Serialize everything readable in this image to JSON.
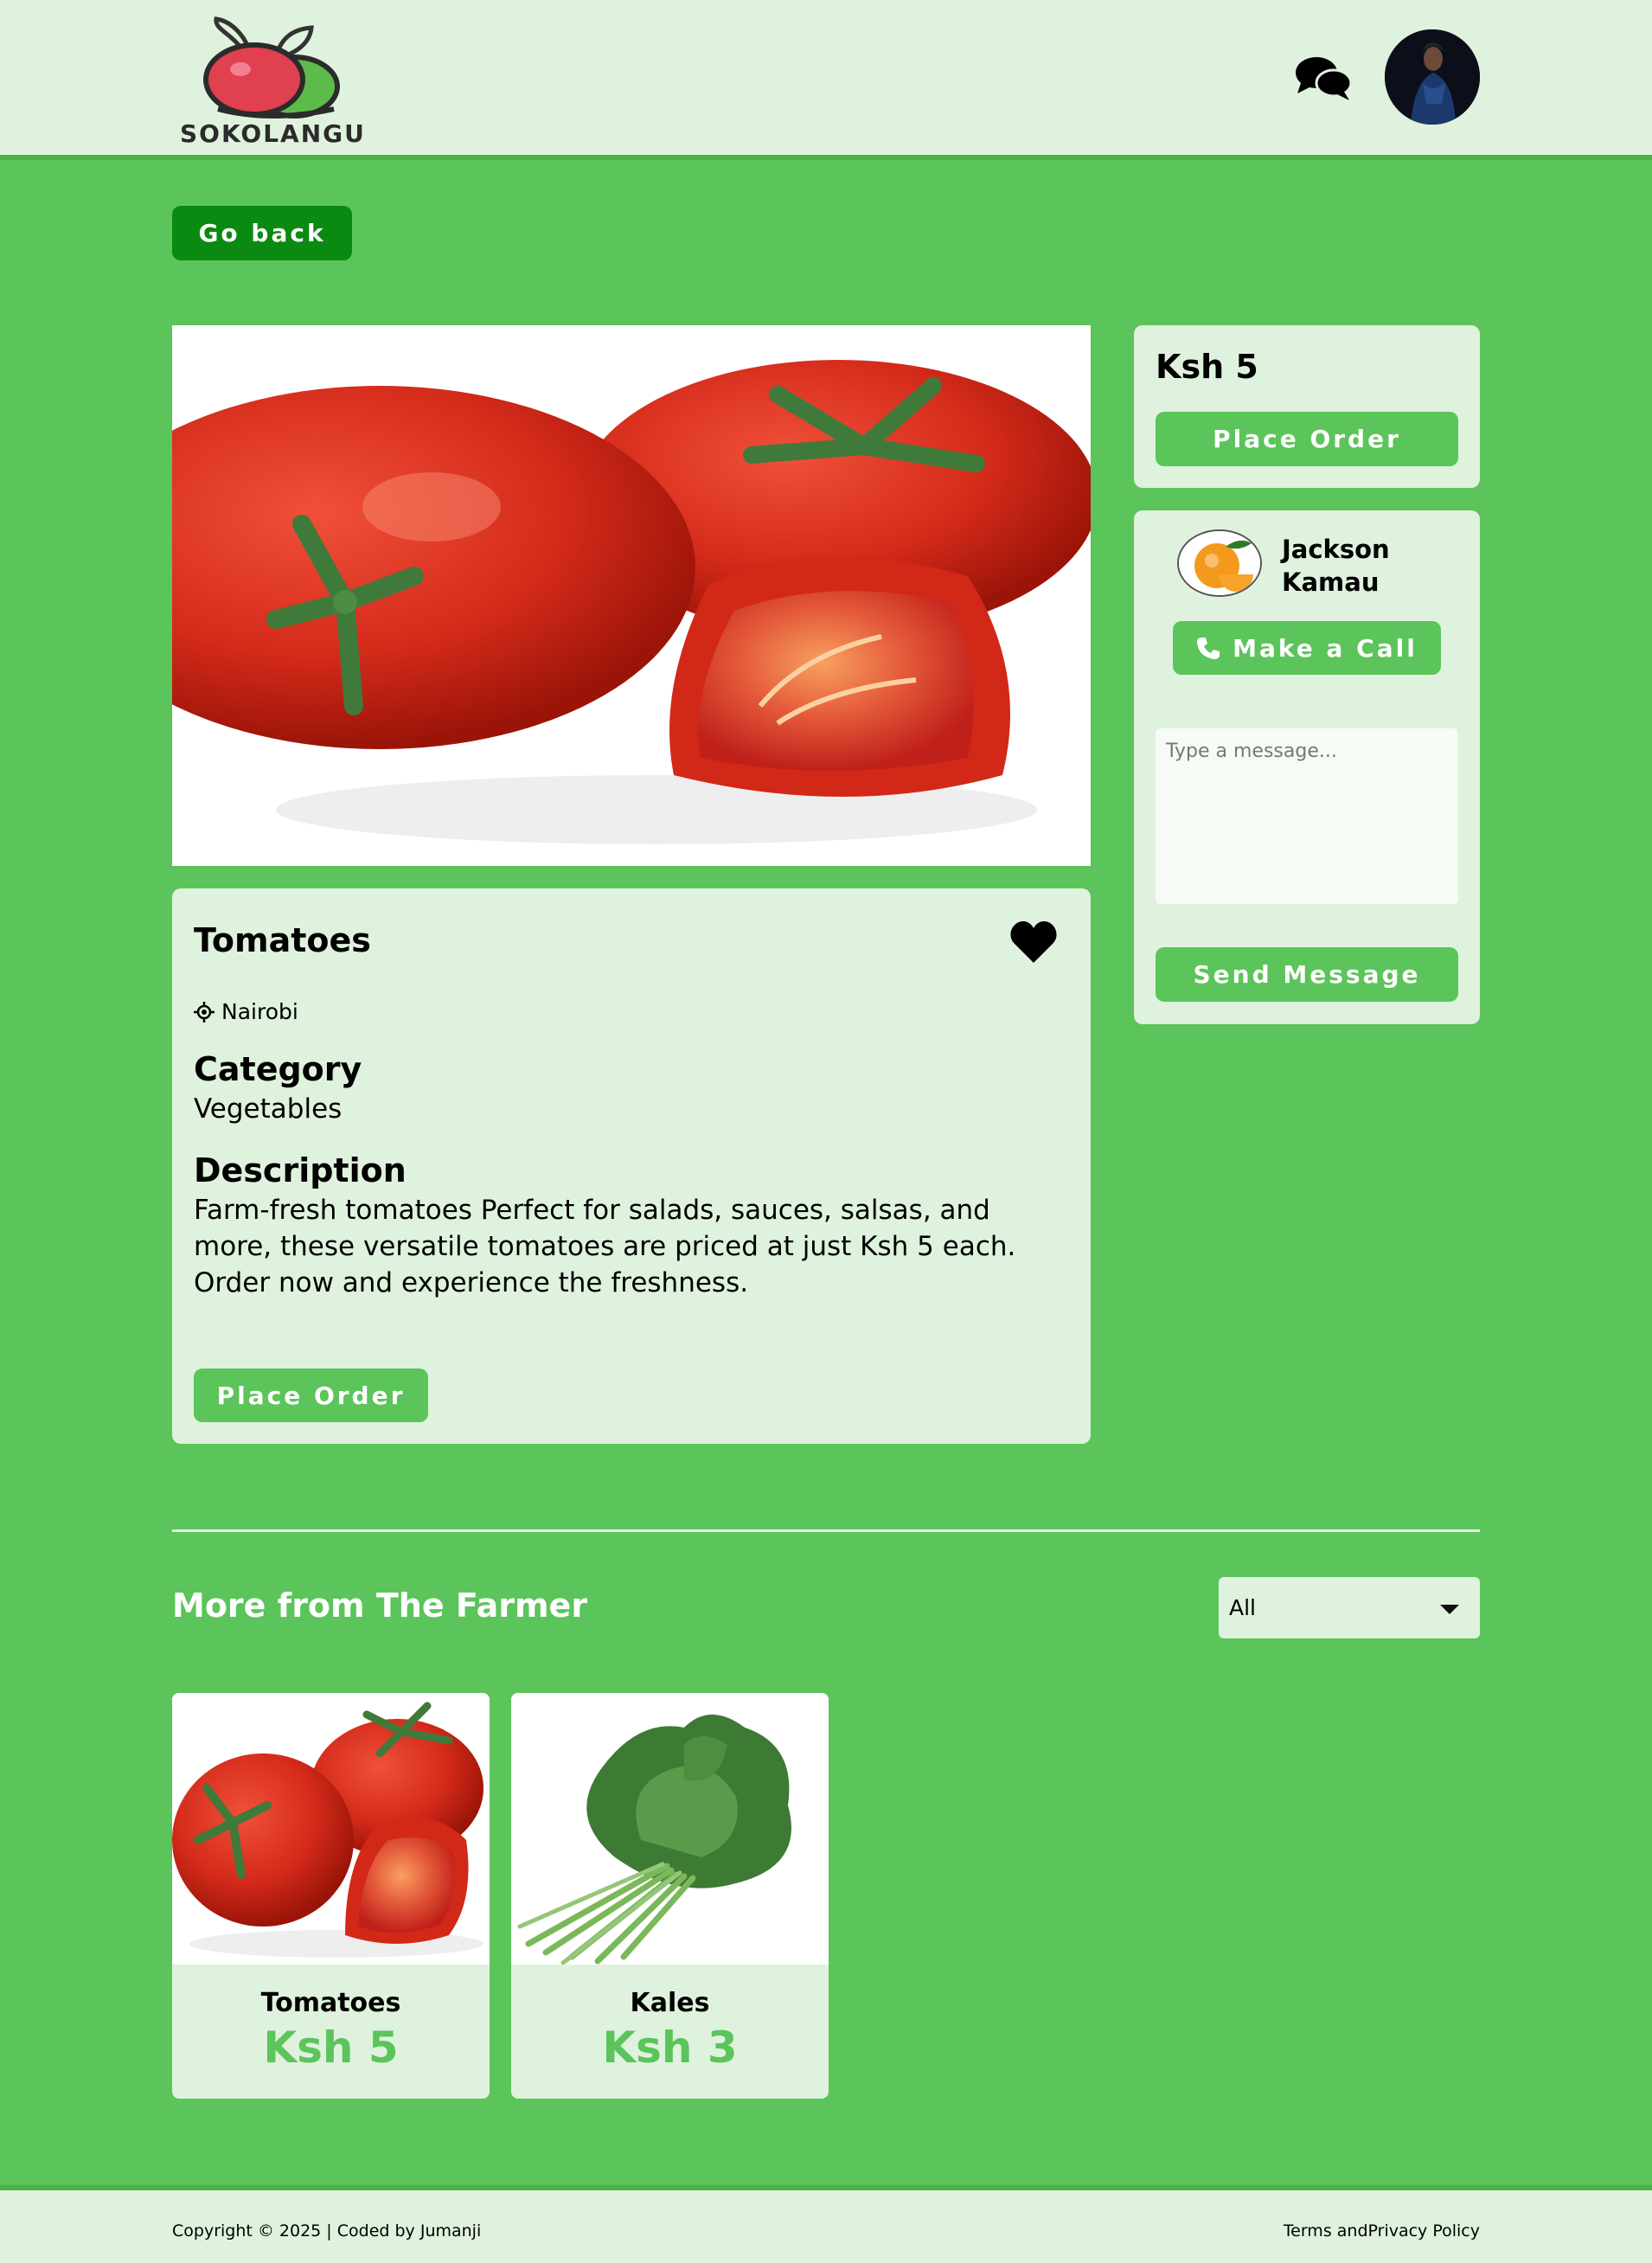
{
  "header": {
    "logo_text": "SOKOLANGU"
  },
  "actions": {
    "go_back": "Go back"
  },
  "product": {
    "title": "Tomatoes",
    "location": "Nairobi",
    "category_heading": "Category",
    "category": "Vegetables",
    "description_heading": "Description",
    "description": "Farm-fresh tomatoes Perfect for salads, sauces, salsas, and more, these versatile tomatoes are priced at just Ksh 5 each. Order now and experience the freshness.",
    "place_order": "Place Order"
  },
  "sidebar": {
    "price": "Ksh 5",
    "place_order": "Place Order",
    "seller_name": "Jackson Kamau",
    "call_label": "Make a Call",
    "message_placeholder": "Type a message...",
    "send_label": "Send Message"
  },
  "more": {
    "title": "More from The Farmer",
    "filter_value": "All",
    "items": [
      {
        "name": "Tomatoes",
        "price": "Ksh 5"
      },
      {
        "name": "Kales",
        "price": "Ksh 3"
      }
    ]
  },
  "footer": {
    "copyright": "Copyright © 2025 | Coded by Jumanji",
    "terms": "Terms andPrivacy Policy"
  },
  "colors": {
    "page_bg": "#5bc45a",
    "card_bg": "#dff2dd",
    "dark_button": "#0a8a10",
    "accent": "#5bc45a"
  }
}
